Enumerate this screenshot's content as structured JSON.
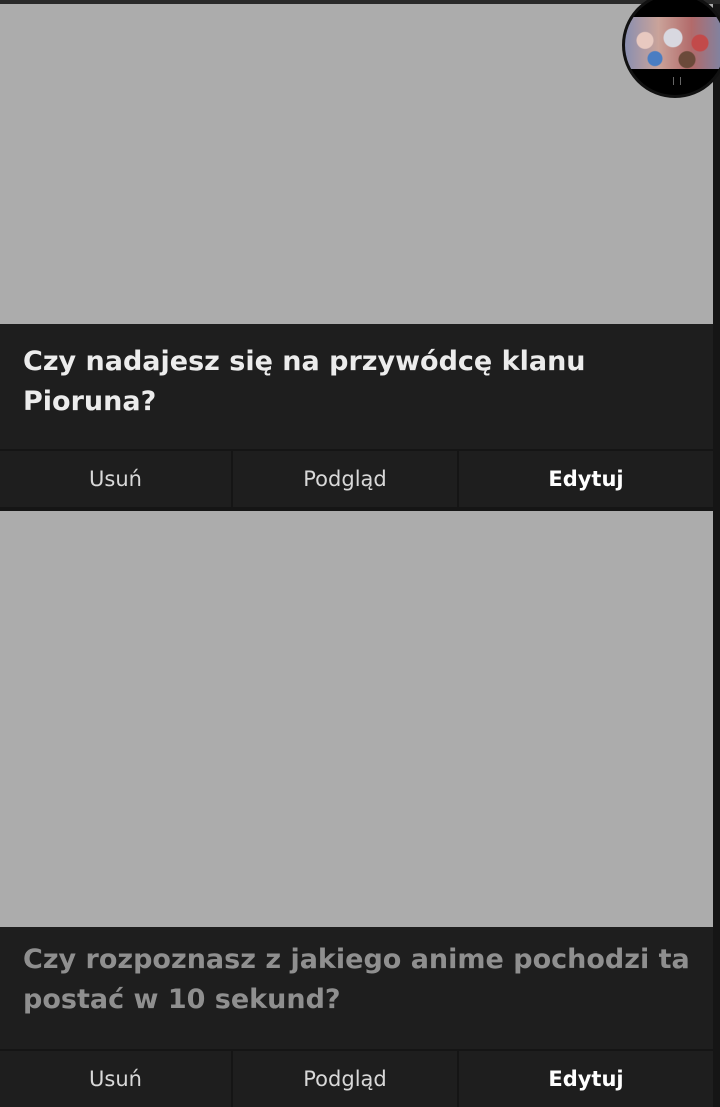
{
  "quizzes": [
    {
      "title": "Czy nadajesz się na przywódcę klanu Pioruna?",
      "delete_label": "Usuń",
      "preview_label": "Podgląd",
      "edit_label": "Edytuj"
    },
    {
      "title": "Czy rozpoznasz z jakiego anime pochodzi ta postać w 10 sekund?",
      "delete_label": "Usuń",
      "preview_label": "Podgląd",
      "edit_label": "Edytuj"
    }
  ],
  "colors": {
    "background": "#151515",
    "card": "#1e1e1e",
    "thumbnail_placeholder": "#acacac",
    "title_primary": "#ececec",
    "title_muted": "#8f8f8f"
  },
  "icons": {
    "avatar": "user-avatar-image"
  }
}
